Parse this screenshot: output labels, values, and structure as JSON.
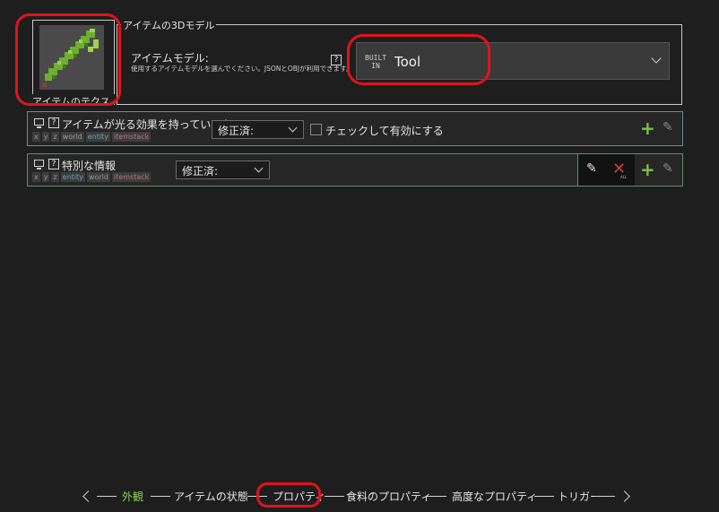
{
  "texture": {
    "label": "アイテムのテクス..."
  },
  "model_group": {
    "title": "アイテムの3Dモデル",
    "label": "アイテムモデル:",
    "help": "使用するアイテムモデルを選んでください。JSONとOBJが利用できます。",
    "help_icon": "?",
    "builtin_line1": "BUILT",
    "builtin_line2": "IN",
    "value": "Tool"
  },
  "row1": {
    "title": "アイテムが光る効果を持っているか",
    "tags": [
      "x",
      "y",
      "z",
      "world",
      "entity",
      "itemstack"
    ],
    "select": "修正済:",
    "checkbox_label": "チェックして有効にする"
  },
  "row2": {
    "title": "特別な情報",
    "tags": [
      "x",
      "y",
      "z",
      "entity",
      "world",
      "itemstack"
    ],
    "select": "修正済:",
    "all_label": "ALL"
  },
  "nav": {
    "items": [
      "外観",
      "アイテムの状態",
      "プロパティ",
      "食料のプロパティ",
      "高度なプロパティ",
      "トリガー"
    ],
    "active_index": 0
  },
  "colors": {
    "accent_green": "#8fcf58",
    "highlight_red": "#e0131b",
    "delete_red": "#d03a3a"
  }
}
